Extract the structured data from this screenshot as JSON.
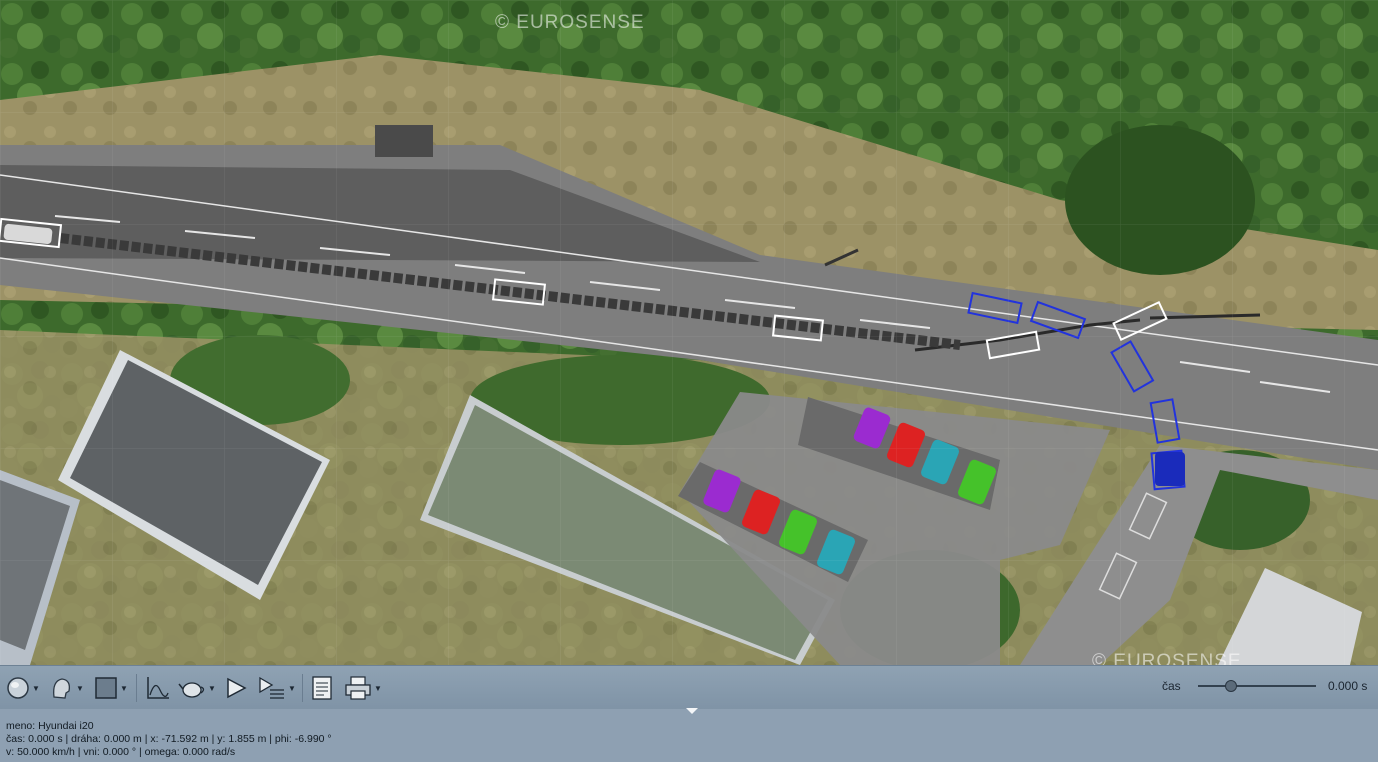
{
  "watermarks": {
    "top": "© EUROSENSE",
    "bottom": "© EUROSENSE"
  },
  "toolbar": {
    "buttons": [
      {
        "name": "view-sphere-button",
        "icon": "sphere-icon",
        "dropdown": true
      },
      {
        "name": "view-head-button",
        "icon": "head-icon",
        "dropdown": true
      },
      {
        "name": "view-rect-button",
        "icon": "rectangle-icon",
        "dropdown": true
      },
      {
        "name": "graph-button",
        "icon": "graph-icon",
        "dropdown": false
      },
      {
        "name": "teapot-button",
        "icon": "teapot-icon",
        "dropdown": true
      },
      {
        "name": "play-button",
        "icon": "play-icon",
        "dropdown": false
      },
      {
        "name": "play-list-button",
        "icon": "play-list-icon",
        "dropdown": true
      },
      {
        "name": "report-button",
        "icon": "report-icon",
        "dropdown": false
      },
      {
        "name": "print-button",
        "icon": "printer-icon",
        "dropdown": true
      }
    ],
    "time_label": "čas",
    "time_value": "0.000 s",
    "slider_fraction": 0.28
  },
  "info": {
    "line1": "meno: Hyundai i20",
    "line2": "čas: 0.000 s | dráha: 0.000 m | x: -71.592 m | y: 1.855 m | phi: -6.990 °",
    "line3": "v: 50.000 km/h | vni: 0.000 ° | omega: 0.000 rad/s"
  },
  "colors": {
    "toolbar_bg": "#8496a8",
    "info_bg": "#8ea0b2",
    "road": "#7c7c7c",
    "trajectory_boxes_white": "#ffffff",
    "trajectory_boxes_blue": "#2233dd",
    "parked_cars": [
      "#9b2bd0",
      "#dd2222",
      "#2aa5b5",
      "#45c22a"
    ]
  }
}
